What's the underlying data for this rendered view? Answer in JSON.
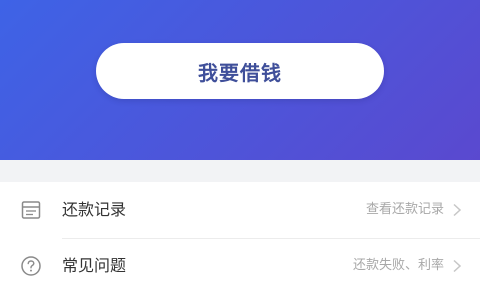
{
  "hero": {
    "borrow_button_label": "我要借钱",
    "gradient_start": "#3e63e6",
    "gradient_end": "#5a49cf"
  },
  "menu": {
    "items": [
      {
        "icon": "calendar-record-icon",
        "label": "还款记录",
        "hint": "查看还款记录"
      },
      {
        "icon": "question-circle-icon",
        "label": "常见问题",
        "hint": "还款失败、利率"
      }
    ]
  }
}
